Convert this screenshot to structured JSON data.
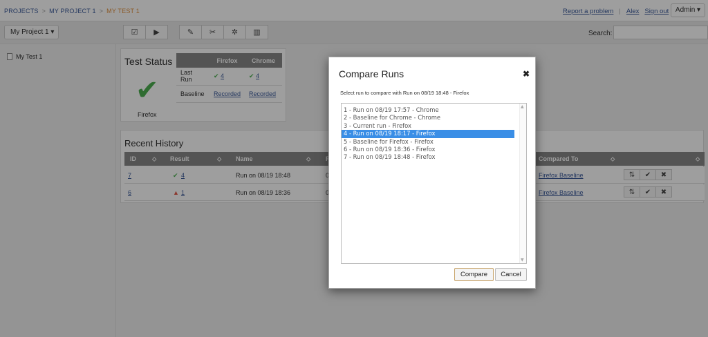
{
  "breadcrumb": {
    "projects": "PROJECTS",
    "project": "MY PROJECT 1",
    "test": "MY TEST 1",
    "separator": ">"
  },
  "topnav": {
    "report": "Report a problem",
    "user": "Alex",
    "signout": "Sign out",
    "admin": "Admin ▾"
  },
  "toolbar": {
    "project_dropdown": "My Project 1 ▾",
    "icons": [
      "checkbox-icon",
      "play-icon",
      "pencil-icon",
      "tools-icon",
      "gear-icon",
      "trash-icon"
    ],
    "search_label": "Search:"
  },
  "sidebar": {
    "items": [
      {
        "label": "My Test 1"
      }
    ]
  },
  "test_status": {
    "title": "Test Status",
    "current_browser": "Firefox",
    "columns": [
      "Firefox",
      "Chrome"
    ],
    "rows": [
      {
        "label": "Last Run",
        "cells": [
          "4",
          "4"
        ]
      },
      {
        "label": "Baseline",
        "cells": [
          "Recorded",
          "Recorded"
        ]
      }
    ]
  },
  "recent_history": {
    "title": "Recent History",
    "headers": {
      "id": "ID",
      "result": "Result",
      "name": "Name",
      "r": "R",
      "compared_to": "Compared To"
    },
    "sort_glyph": "⬦",
    "rows": [
      {
        "id": "7",
        "result_count": "4",
        "result_status": "pass",
        "name": "Run on 08/19 18:48",
        "r": "08",
        "compared": "Firefox Baseline"
      },
      {
        "id": "6",
        "result_count": "1",
        "result_status": "warn",
        "name": "Run on 08/19 18:36",
        "r": "08",
        "compared": "Firefox Baseline"
      }
    ]
  },
  "modal": {
    "title": "Compare Runs",
    "close": "✖",
    "subtitle": "Select run to compare with Run on 08/19 18:48 - Firefox",
    "runs": [
      "1 - Run on 08/19 17:57 - Chrome",
      "2 - Baseline for Chrome - Chrome",
      "3 - Current run - Firefox",
      "4 - Run on 08/19 18:17 - Firefox",
      "5 - Baseline for Firefox - Firefox",
      "6 - Run on 08/19 18:36 - Firefox",
      "7 - Run on 08/19 18:48 - Firefox"
    ],
    "selected_run": "4 - Run on 08/19 18:17 - Firefox",
    "compare_button": "Compare",
    "cancel_button": "Cancel"
  },
  "colors": {
    "accent_orange": "#e09040",
    "link_blue": "#3a5a9a",
    "pass_green": "#4caf50",
    "warn_red": "#e05a4a",
    "selection_blue": "#3a8ee6"
  }
}
